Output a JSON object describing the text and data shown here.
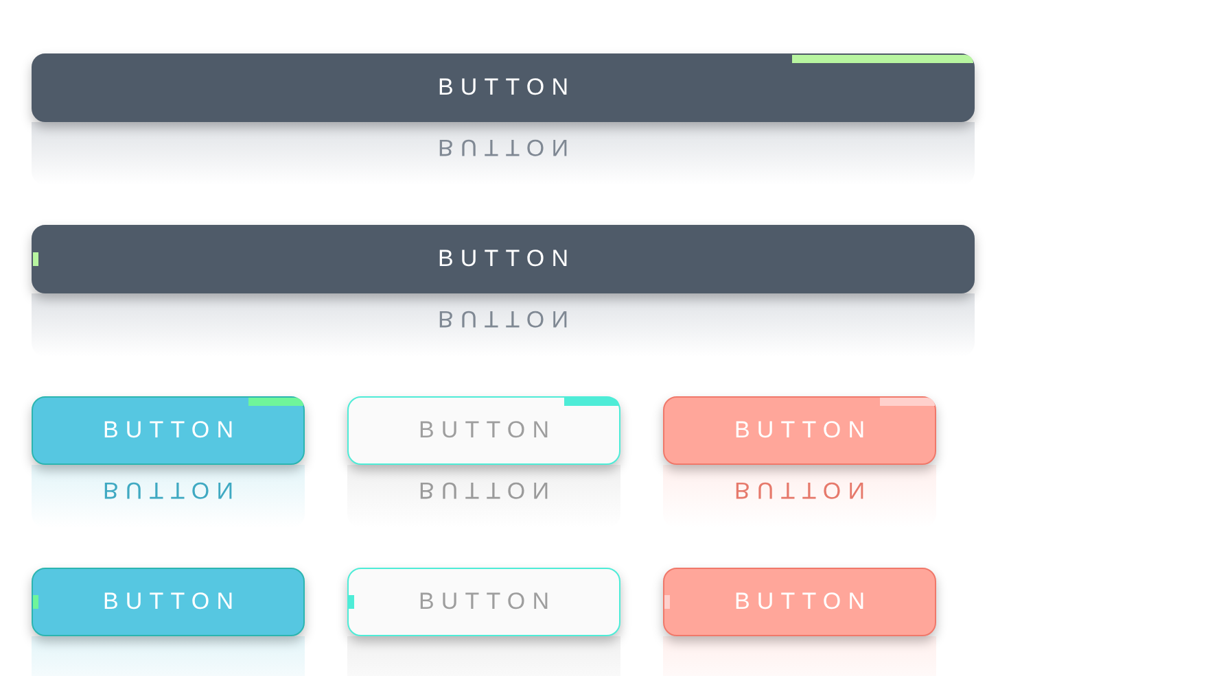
{
  "rows": [
    {
      "buttons": [
        {
          "label": "BUTTON",
          "reflection": "BUTTON",
          "color": "#4f5b69",
          "kind": "corner"
        }
      ]
    },
    {
      "buttons": [
        {
          "label": "BUTTON",
          "reflection": "BUTTON",
          "color": "#4f5b69",
          "kind": "edge"
        }
      ]
    },
    {
      "buttons": [
        {
          "label": "BUTTON",
          "reflection": "BUTTON",
          "color": "#56c7e1",
          "kind": "corner"
        },
        {
          "label": "BUTTON",
          "reflection": "BUTTON",
          "color": "#fafafa",
          "kind": "corner"
        },
        {
          "label": "BUTTON",
          "reflection": "BUTTON",
          "color": "#ffa69a",
          "kind": "corner"
        }
      ]
    },
    {
      "buttons": [
        {
          "label": "BUTTON",
          "color": "#56c7e1",
          "kind": "edge"
        },
        {
          "label": "BUTTON",
          "color": "#fafafa",
          "kind": "edge"
        },
        {
          "label": "BUTTON",
          "color": "#ffa69a",
          "kind": "edge"
        }
      ]
    }
  ]
}
